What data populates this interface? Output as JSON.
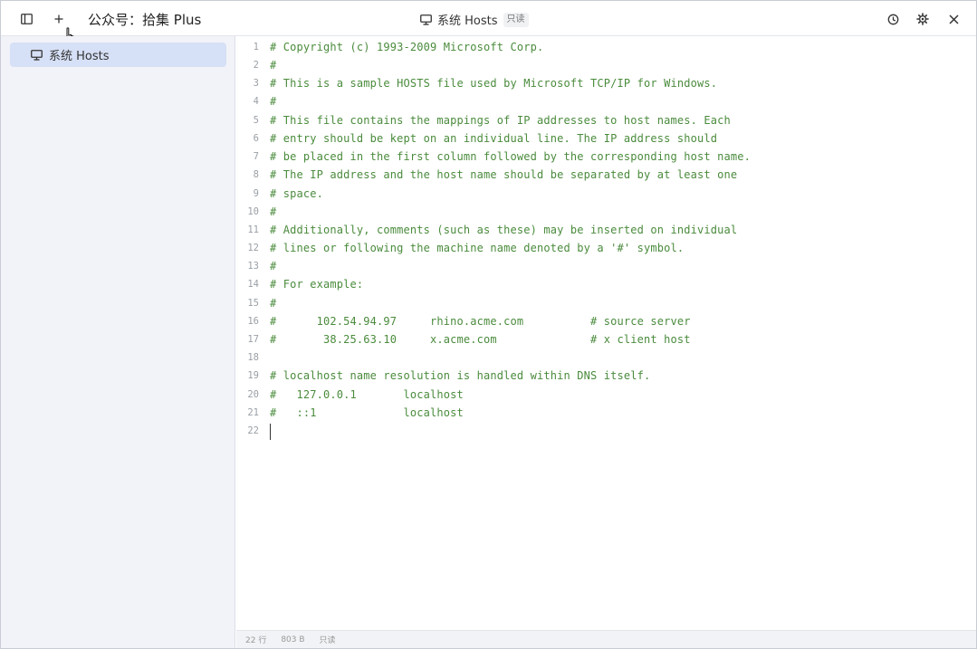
{
  "titlebar": {
    "app_title": "公众号：拾集 Plus",
    "center_title": "系统 Hosts",
    "readonly_badge": "只读",
    "icons": [
      "sidebar-toggle-icon",
      "plus-icon",
      "history-icon",
      "gear-icon",
      "close-icon"
    ]
  },
  "sidebar": {
    "items": [
      {
        "label": "系统 Hosts",
        "icon": "monitor-icon",
        "selected": true
      }
    ]
  },
  "editor": {
    "lines": [
      {
        "num": "1",
        "text": "# Copyright (c) 1993-2009 Microsoft Corp."
      },
      {
        "num": "2",
        "text": "#"
      },
      {
        "num": "3",
        "text": "# This is a sample HOSTS file used by Microsoft TCP/IP for Windows."
      },
      {
        "num": "4",
        "text": "#"
      },
      {
        "num": "5",
        "text": "# This file contains the mappings of IP addresses to host names. Each"
      },
      {
        "num": "6",
        "text": "# entry should be kept on an individual line. The IP address should"
      },
      {
        "num": "7",
        "text": "# be placed in the first column followed by the corresponding host name."
      },
      {
        "num": "8",
        "text": "# The IP address and the host name should be separated by at least one"
      },
      {
        "num": "9",
        "text": "# space."
      },
      {
        "num": "10",
        "text": "#"
      },
      {
        "num": "11",
        "text": "# Additionally, comments (such as these) may be inserted on individual"
      },
      {
        "num": "12",
        "text": "# lines or following the machine name denoted by a '#' symbol."
      },
      {
        "num": "13",
        "text": "#"
      },
      {
        "num": "14",
        "text": "# For example:"
      },
      {
        "num": "15",
        "text": "#"
      },
      {
        "num": "16",
        "text": "#      102.54.94.97     rhino.acme.com          # source server"
      },
      {
        "num": "17",
        "text": "#       38.25.63.10     x.acme.com              # x client host"
      },
      {
        "num": "18",
        "text": ""
      },
      {
        "num": "19",
        "text": "# localhost name resolution is handled within DNS itself."
      },
      {
        "num": "20",
        "text": "#   127.0.0.1       localhost"
      },
      {
        "num": "21",
        "text": "#   ::1             localhost"
      },
      {
        "num": "22",
        "text": ""
      }
    ]
  },
  "statusbar": {
    "line_count": "22 行",
    "encoding": "803 B",
    "mode": "只读"
  },
  "colors": {
    "comment": "#4a8b3c",
    "sidebar_bg": "#f2f3f8",
    "selected_bg": "#d6e0f6"
  }
}
